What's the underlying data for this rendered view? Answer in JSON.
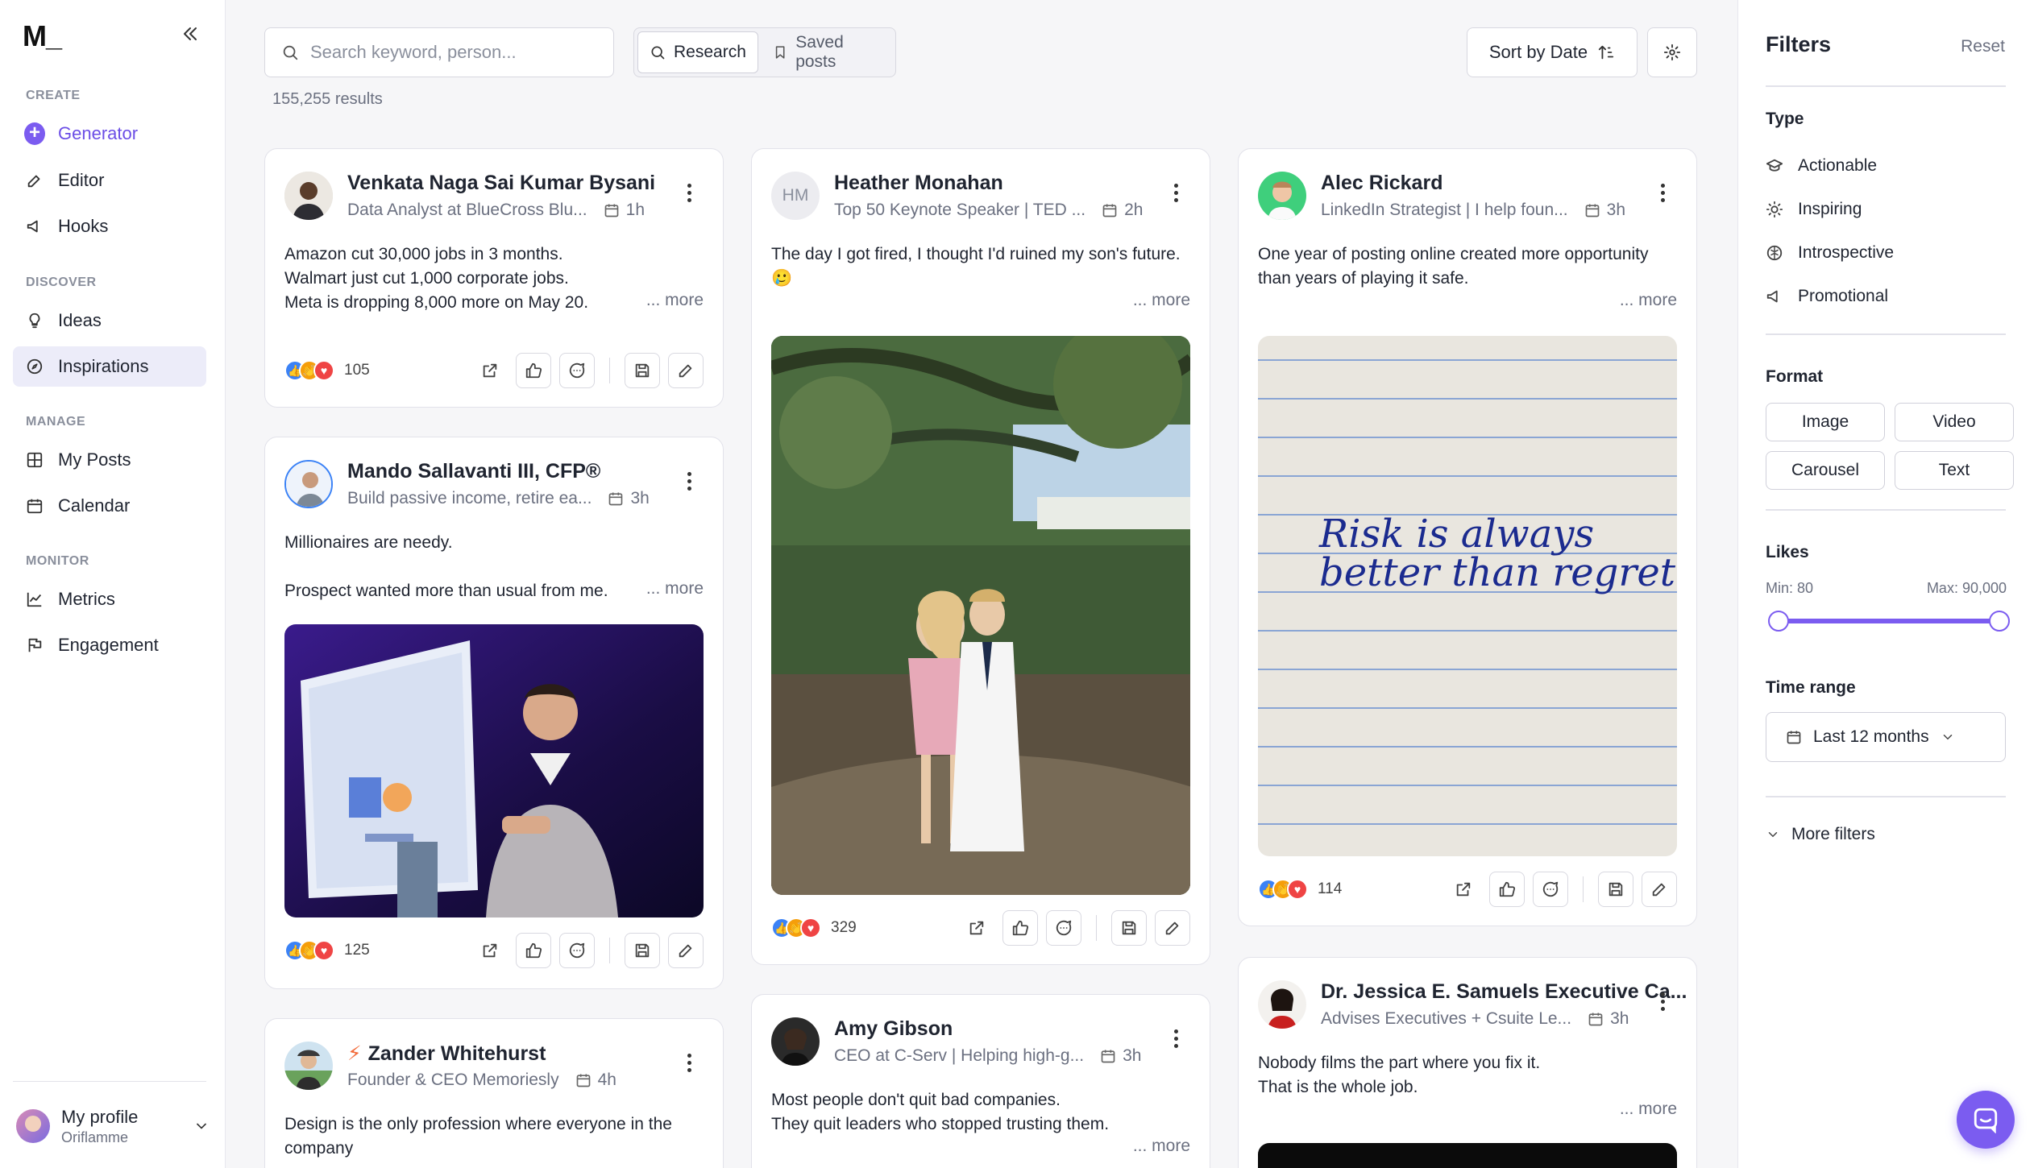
{
  "app": {
    "logo": "M_"
  },
  "sidebar": {
    "sections": [
      {
        "label": "CREATE"
      },
      {
        "label": "DISCOVER"
      },
      {
        "label": "MANAGE"
      },
      {
        "label": "MONITOR"
      }
    ],
    "items": [
      {
        "label": "Generator",
        "icon": "plus-circle-icon"
      },
      {
        "label": "Editor",
        "icon": "edit-icon"
      },
      {
        "label": "Hooks",
        "icon": "megaphone-icon"
      },
      {
        "label": "Ideas",
        "icon": "lightbulb-icon"
      },
      {
        "label": "Inspirations",
        "icon": "compass-icon",
        "active": true
      },
      {
        "label": "My Posts",
        "icon": "grid-icon"
      },
      {
        "label": "Calendar",
        "icon": "calendar-icon"
      },
      {
        "label": "Metrics",
        "icon": "chart-line-icon"
      },
      {
        "label": "Engagement",
        "icon": "flag-icon"
      }
    ],
    "profile": {
      "name": "My profile",
      "org": "Oriflamme"
    }
  },
  "toolbar": {
    "search_placeholder": "Search keyword, person...",
    "tabs": [
      {
        "label": "Research",
        "active": true
      },
      {
        "label": "Saved posts",
        "active": false
      }
    ],
    "results": "155,255 results",
    "sort_label": "Sort by Date"
  },
  "posts": [
    {
      "name": "Venkata Naga Sai Kumar Bysani",
      "subtitle": "Data Analyst at BlueCross Blu...",
      "time": "1h",
      "lines": [
        "Amazon cut 30,000 jobs in 3 months.",
        "Walmart just cut 1,000 corporate jobs.",
        "Meta is dropping 8,000 more on May 20."
      ],
      "more": "... more",
      "reactions": "105"
    },
    {
      "name": "Mando Sallavanti III, CFP®",
      "subtitle": "Build passive income, retire ea...",
      "time": "3h",
      "lines": [
        "Millionaires are needy.",
        "",
        "Prospect wanted more than usual from me."
      ],
      "more": "... more",
      "reactions": "125"
    },
    {
      "name": "Zander Whitehurst",
      "subtitle": "Founder & CEO Memoriesly",
      "time": "4h",
      "lines": [
        "Design is the only profession where everyone in the",
        "company"
      ]
    },
    {
      "name": "Heather Monahan",
      "initials": "HM",
      "subtitle": "Top 50 Keynote Speaker | TED ...",
      "time": "2h",
      "lines": [
        "The day I got fired, I thought I'd ruined my son's future."
      ],
      "emoji": "🥲",
      "more": "... more",
      "reactions": "329"
    },
    {
      "name": "Amy Gibson",
      "subtitle": "CEO at C-Serv | Helping high-g...",
      "time": "3h",
      "lines": [
        "Most people don't quit bad companies.",
        "They quit leaders who stopped trusting them."
      ],
      "more": "... more"
    },
    {
      "name": "Alec Rickard",
      "subtitle": "LinkedIn Strategist | I help foun...",
      "time": "3h",
      "lines": [
        "One year of posting online created more opportunity",
        "than years of playing it safe."
      ],
      "more": "... more",
      "reactions": "114",
      "handwriting": [
        "Risk is always",
        "better than regret"
      ]
    },
    {
      "name": "Dr. Jessica E. Samuels Executive Ca...",
      "subtitle": "Advises Executives + Csuite Le...",
      "time": "3h",
      "lines": [
        "Nobody films the part where you fix it.",
        "That is the whole job."
      ],
      "more": "... more"
    }
  ],
  "filters": {
    "title": "Filters",
    "reset": "Reset",
    "type_label": "Type",
    "types": [
      {
        "label": "Actionable",
        "icon": "graduation-cap-icon"
      },
      {
        "label": "Inspiring",
        "icon": "sun-icon"
      },
      {
        "label": "Introspective",
        "icon": "brain-icon"
      },
      {
        "label": "Promotional",
        "icon": "megaphone-icon"
      }
    ],
    "format_label": "Format",
    "formats": [
      "Image",
      "Video",
      "Carousel",
      "Text"
    ],
    "likes_label": "Likes",
    "likes_min": "Min: 80",
    "likes_max": "Max: 90,000",
    "likes_range_fraction": [
      0.0,
      1.0
    ],
    "time_label": "Time range",
    "time_value": "Last 12 months",
    "more_filters": "More filters"
  },
  "colors": {
    "accent": "#7b5cf0",
    "active_nav_bg": "#ececf9",
    "page_bg": "#f6f6f8"
  }
}
